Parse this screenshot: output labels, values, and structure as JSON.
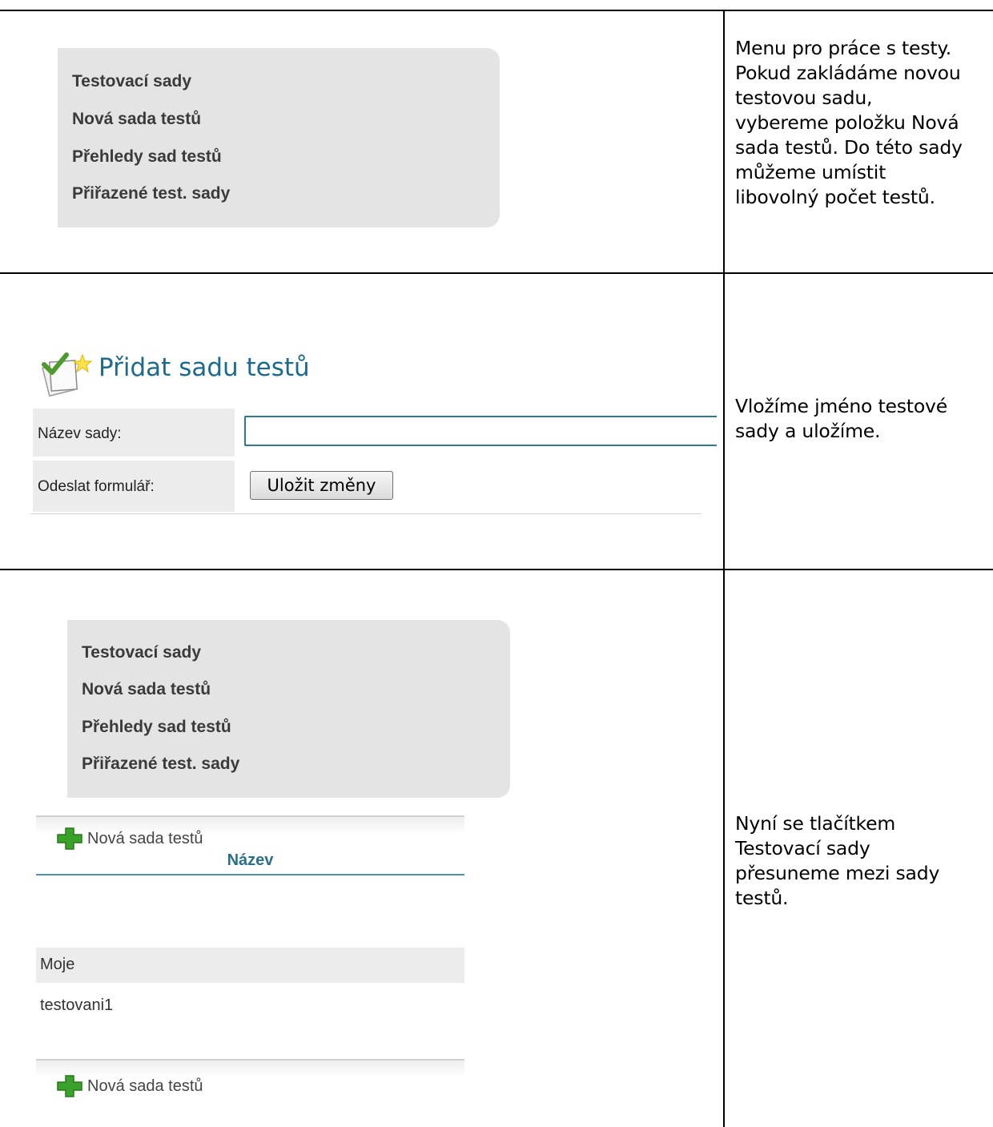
{
  "section1": {
    "menu_items": [
      "Testovací sady",
      "Nová sada testů",
      "Přehledy sad testů",
      "Přiřazené test. sady"
    ],
    "description": [
      "Menu pro práce s testy.",
      "Pokud zakládáme novou",
      "testovou sadu,",
      "vybereme položku Nová",
      "sada testů. Do této sady",
      "můžeme umístit",
      "libovolný počet testů."
    ]
  },
  "section2": {
    "title": "Přidat sadu testů",
    "name_label": "Název sady:",
    "name_value": "",
    "submit_label": "Odeslat formulář:",
    "save_button": "Uložit změny",
    "description": [
      "Vložíme jméno testové",
      "sady a uložíme."
    ]
  },
  "section3": {
    "menu_items": [
      "Testovací sady",
      "Nová sada testů",
      "Přehledy sad testů",
      "Přiřazené test. sady"
    ],
    "add_link": "Nová sada testů",
    "column_header": "Název",
    "rows": [
      "Moje",
      "testovani1"
    ],
    "description": [
      "Nyní se tlačítkem",
      "Testovací sady",
      "přesuneme mezi sady",
      "testů."
    ]
  },
  "colors": {
    "menu_bg": "#e4e4e4",
    "title_blue": "#1d6a8f",
    "header_blue": "#2a6f8a",
    "plus_green": "#3aa12a",
    "row_highlight": "#ececec"
  },
  "icons": [
    "add-test-set-icon",
    "plus-icon"
  ]
}
